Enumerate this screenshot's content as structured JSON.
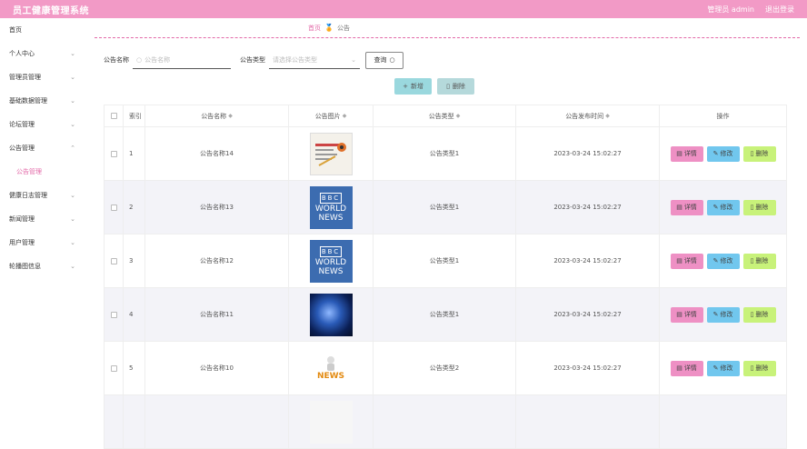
{
  "app": {
    "title": "员工健康管理系统",
    "user": "管理员 admin",
    "logout": "退出登录"
  },
  "sidebar": {
    "items": [
      {
        "label": "首页",
        "chevron": false
      },
      {
        "label": "个人中心",
        "chevron": true
      },
      {
        "label": "管理员管理",
        "chevron": true
      },
      {
        "label": "基础数据管理",
        "chevron": true
      },
      {
        "label": "论坛管理",
        "chevron": true
      },
      {
        "label": "公告管理",
        "chevron": true,
        "expanded": true
      },
      {
        "label": "公告管理",
        "sub": true
      },
      {
        "label": "健康日志管理",
        "chevron": true
      },
      {
        "label": "新闻管理",
        "chevron": true
      },
      {
        "label": "用户管理",
        "chevron": true
      },
      {
        "label": "轮播图信息",
        "chevron": true
      }
    ]
  },
  "breadcrumb": {
    "home": "首页",
    "current": "公告"
  },
  "search": {
    "name_label": "公告名称",
    "name_placeholder": "公告名称",
    "type_label": "公告类型",
    "type_placeholder": "请选择公告类型",
    "query_label": "查询"
  },
  "actions": {
    "add": "新增",
    "delete": "删除"
  },
  "table": {
    "headers": {
      "index": "索引",
      "name": "公告名称",
      "image": "公告图片",
      "type": "公告类型",
      "time": "公告发布时间",
      "ops": "操作"
    },
    "op_labels": {
      "detail": "详情",
      "edit": "修改",
      "delete": "删除"
    },
    "rows": [
      {
        "index": "1",
        "name": "公告名称14",
        "image": "paper",
        "type": "公告类型1",
        "time": "2023-03-24 15:02:27"
      },
      {
        "index": "2",
        "name": "公告名称13",
        "image": "bbc",
        "type": "公告类型1",
        "time": "2023-03-24 15:02:27"
      },
      {
        "index": "3",
        "name": "公告名称12",
        "image": "bbc",
        "type": "公告类型1",
        "time": "2023-03-24 15:02:27"
      },
      {
        "index": "4",
        "name": "公告名称11",
        "image": "globe",
        "type": "公告类型1",
        "time": "2023-03-24 15:02:27"
      },
      {
        "index": "5",
        "name": "公告名称10",
        "image": "news3d",
        "type": "公告类型2",
        "time": "2023-03-24 15:02:27"
      }
    ]
  },
  "images": {
    "bbc_logo": "BBC",
    "bbc_line1": "WORLD",
    "bbc_line2": "NEWS",
    "news3d_text": "NEWS"
  },
  "colors": {
    "brand": "#f29ac6",
    "accent": "#e36aa8",
    "detail": "#ee90c4",
    "edit": "#71c7ee",
    "remove": "#c8f27a"
  }
}
